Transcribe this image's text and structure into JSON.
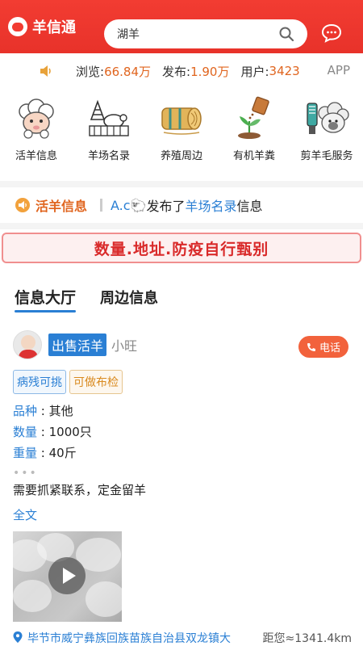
{
  "header": {
    "app_name": "羊信通",
    "search_value": "湖羊"
  },
  "stats": {
    "views_label": "浏览:",
    "views_value": "66.84万",
    "posts_label": "发布:",
    "posts_value": "1.90万",
    "users_label": "用户:",
    "users_value": "3423",
    "app_label": "APP"
  },
  "categories": [
    {
      "label": "活羊信息",
      "icon": "sheep-icon"
    },
    {
      "label": "羊场名录",
      "icon": "farm-icon"
    },
    {
      "label": "养殖周边",
      "icon": "hay-bale-icon"
    },
    {
      "label": "有机羊粪",
      "icon": "fertilizer-icon"
    },
    {
      "label": "剪羊毛服务",
      "icon": "shearing-icon"
    }
  ],
  "ticker": {
    "title": "活羊信息",
    "user": "A.c🐑",
    "text_mid": "发布了",
    "link": "羊场名录",
    "text_end": "信息"
  },
  "banner": {
    "text": "数量.地址.防疫自行甄别"
  },
  "tabs": [
    {
      "label": "信息大厅",
      "active": true
    },
    {
      "label": "周边信息",
      "active": false
    }
  ],
  "post": {
    "type": "出售活羊",
    "user": "小旺",
    "call_label": "电话",
    "tags": [
      "病残可挑",
      "可做布检"
    ],
    "fields": [
      {
        "key": "品种",
        "value": "其他"
      },
      {
        "key": "数量",
        "value": "1000只"
      },
      {
        "key": "重量",
        "value": "40斤"
      }
    ],
    "dots": "•••",
    "description": "需要抓紧联系，定金留羊",
    "full_text_label": "全文",
    "location": "毕节市威宁彝族回族苗族自治县双龙镇大",
    "distance": "距您≈1341.4km"
  },
  "colors": {
    "header_red": "#f23c32",
    "accent_blue": "#2a7fd4",
    "accent_orange": "#e0651f",
    "warning_red": "#d92a2a"
  }
}
